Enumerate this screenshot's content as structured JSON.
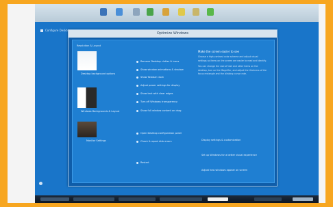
{
  "window_title": "Optimize Windows",
  "desktop_label": "Configure Desktop",
  "thumbnail_caption": "Resolution & Layout",
  "thumbnails": [
    {
      "caption": "Desktop background options"
    },
    {
      "caption": "Windows Backgrounds & Layout"
    },
    {
      "caption": "Monitor Settings"
    }
  ],
  "options": [
    "Remove Desktop clutter & icons",
    "Show window animations & shadow",
    "Show Taskbar clock",
    "Adjust power settings for display",
    "Show text with clear edges",
    "Turn off Windows transparency",
    "Show full window content on drag",
    "Open Desktop configuration panel",
    "Check & repair disk errors",
    "Restart"
  ],
  "description": {
    "heading": "Make the screen easier to see",
    "paragraphs": [
      "Choose a high-contrast color scheme and adjust visual settings so items on the screen are easier to read and identify.",
      "You can change the size of text and other items on the desktop, turn on the Magnifier, and adjust the thickness of the focus rectangle and the blinking cursor rate."
    ]
  },
  "links": [
    "Display settings & customization",
    "Set up Windows for a better visual experience",
    "Adjust how windows appear on screen"
  ],
  "colors": {
    "bezel": "#f7a620",
    "desktop": "#1975c9",
    "dialog_panel": "#1f7fd2"
  }
}
